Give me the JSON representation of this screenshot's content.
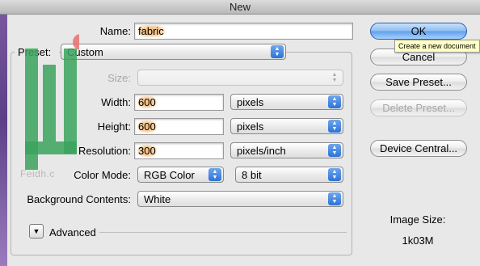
{
  "window": {
    "title": "New"
  },
  "name": {
    "label": "Name:",
    "value": "fabric"
  },
  "preset": {
    "label": "Preset:",
    "value": "Custom"
  },
  "size": {
    "label": "Size:",
    "value": ""
  },
  "width": {
    "label": "Width:",
    "value": "600",
    "unit": "pixels"
  },
  "height": {
    "label": "Height:",
    "value": "600",
    "unit": "pixels"
  },
  "resolution": {
    "label": "Resolution:",
    "value": "300",
    "unit": "pixels/inch"
  },
  "color_mode": {
    "label": "Color Mode:",
    "mode": "RGB Color",
    "depth": "8 bit"
  },
  "background_contents": {
    "label": "Background Contents:",
    "value": "White"
  },
  "advanced": {
    "label": "Advanced"
  },
  "buttons": {
    "ok": "OK",
    "cancel": "Cancel",
    "save_preset": "Save Preset...",
    "delete_preset": "Delete Preset...",
    "device_central": "Device Central..."
  },
  "tooltip": "Create a new document",
  "image_size": {
    "label": "Image Size:",
    "value": "1k03M"
  },
  "watermark": {
    "text": "Feidh.c"
  },
  "colors": {
    "accent": "#5f9fec",
    "highlight": "#f7c58b",
    "watermark": "#3aa35c"
  }
}
